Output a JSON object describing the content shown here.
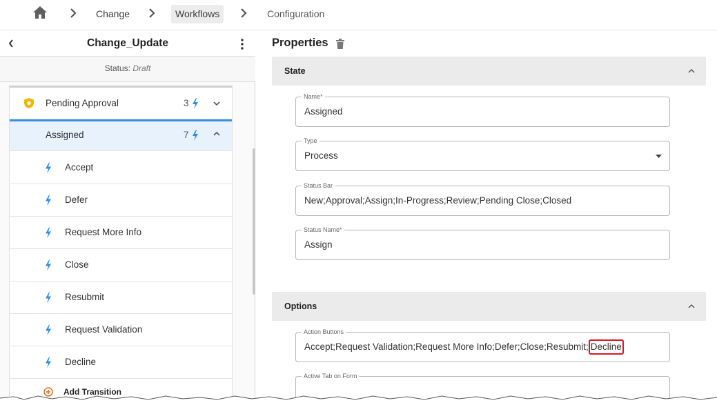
{
  "breadcrumb": {
    "items": [
      {
        "label": "Change"
      },
      {
        "label": "Workflows"
      },
      {
        "label": "Configuration"
      }
    ]
  },
  "left_panel": {
    "title": "Change_Update",
    "status_label": "Status:",
    "status_value": "Draft",
    "states": [
      {
        "label": "Pending Approval",
        "count": "3"
      },
      {
        "label": "Assigned",
        "count": "7"
      }
    ],
    "transitions": [
      {
        "label": "Accept"
      },
      {
        "label": "Defer"
      },
      {
        "label": "Request More Info"
      },
      {
        "label": "Close"
      },
      {
        "label": "Resubmit"
      },
      {
        "label": "Request Validation"
      },
      {
        "label": "Decline"
      }
    ],
    "add_transition_label": "Add Transition"
  },
  "properties": {
    "title": "Properties",
    "state_section": {
      "label": "State",
      "fields": [
        {
          "label": "Name*",
          "value": "Assigned"
        },
        {
          "label": "Type",
          "value": "Process"
        },
        {
          "label": "Status Bar",
          "value": "New;Approval;Assign;In-Progress;Review;Pending Close;Closed"
        },
        {
          "label": "Status Name*",
          "value": "Assign"
        }
      ]
    },
    "options_section": {
      "label": "Options",
      "fields": [
        {
          "label": "Action Buttons",
          "value": "Accept;Request Validation;Request More Info;Defer;Close;Resubmit;",
          "highlighted_value": "Decline"
        },
        {
          "label": "Active Tab on Form",
          "value": ""
        }
      ]
    }
  },
  "colors": {
    "accent": "#3a8ee0",
    "bolt": "#2f8ee5",
    "shield": "#f2b705",
    "highlight": "#e0141e",
    "add": "#e2661d"
  }
}
